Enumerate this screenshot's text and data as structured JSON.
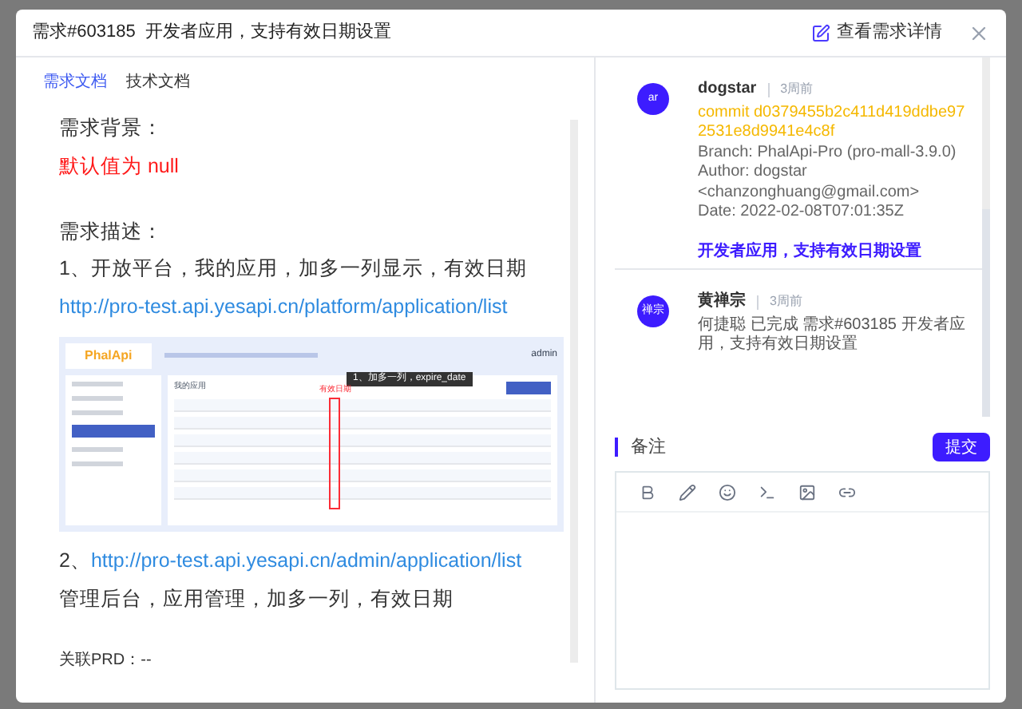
{
  "header": {
    "title": "需求#603185  开发者应用，支持有效日期设置",
    "detail_link": "查看需求详情"
  },
  "doc_tabs": [
    {
      "label": "需求文档",
      "selected": true
    },
    {
      "label": "技术文档",
      "selected": false
    }
  ],
  "document": [
    {
      "kind": "text",
      "text": "需求背景："
    },
    {
      "kind": "red",
      "text": "默认值为 null"
    },
    {
      "kind": "gap"
    },
    {
      "kind": "text",
      "text": "需求描述："
    },
    {
      "kind": "text",
      "text": "1、开放平台，我的应用，加多一列显示，有效日期"
    },
    {
      "kind": "link",
      "text": "http://pro-test.api.yesapi.cn/platform/application/list"
    },
    {
      "kind": "screenshot",
      "logo": "PhalApi",
      "user": "admin",
      "page_title": "我的应用",
      "annotation": "1、加多一列，expire_date",
      "highlight_label": "有效日期"
    },
    {
      "kind": "numbered_link",
      "prefix": "2、",
      "text": "http://pro-test.api.yesapi.cn/admin/application/list"
    },
    {
      "kind": "text",
      "text": "管理后台，应用管理，加多一列，有效日期"
    },
    {
      "kind": "gap"
    },
    {
      "kind": "small",
      "text": "关联PRD：--"
    }
  ],
  "comments": [
    {
      "avatar": "ar",
      "author": "dogstar",
      "time": "3周前",
      "commit": "commit d0379455b2c411d419ddbe972531e8d9941e4c8f",
      "lines": [
        "Branch: PhalApi-Pro (pro-mall-3.9.0)",
        "Author: dogstar <chanzonghuang@gmail.com>",
        "Date: 2022-02-08T07:01:35Z"
      ],
      "title": "开发者应用，支持有效日期设置"
    },
    {
      "avatar": "禅宗",
      "author": "黄禅宗",
      "time": "3周前",
      "body": "何捷聪 已完成 需求#603185 开发者应用，支持有效日期设置"
    }
  ],
  "remark": {
    "label": "备注",
    "submit": "提交"
  }
}
